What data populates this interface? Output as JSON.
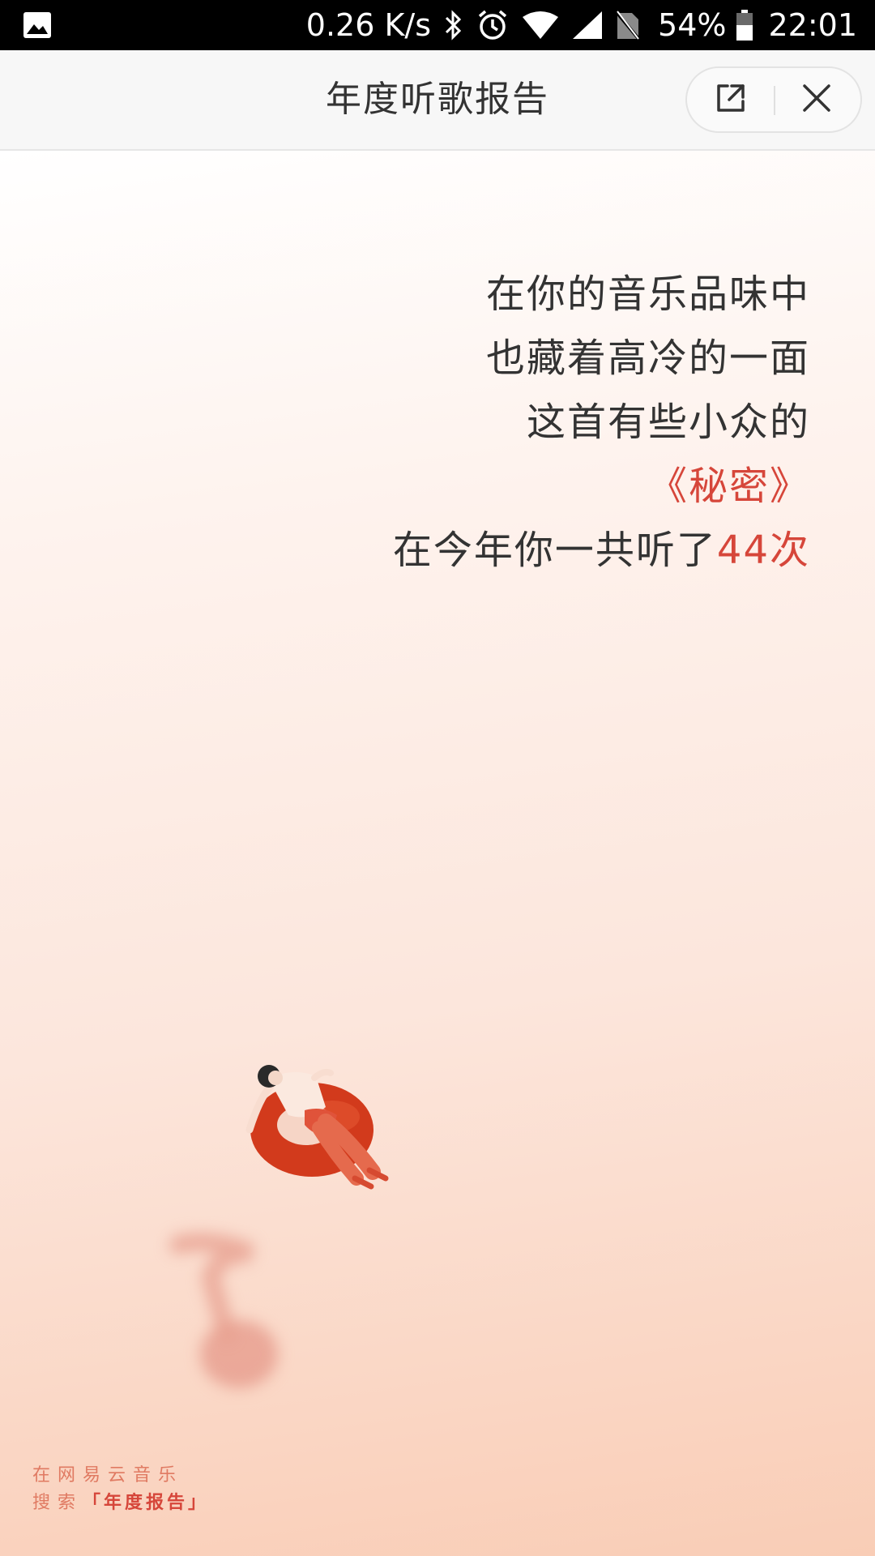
{
  "status_bar": {
    "speed": "0.26 K/s",
    "battery": "54%",
    "time": "22:01"
  },
  "header": {
    "title": "年度听歌报告"
  },
  "report": {
    "line1": "在你的音乐品味中",
    "line2": "也藏着高冷的一面",
    "line3": "这首有些小众的",
    "song": "《秘密》",
    "line5_prefix": "在今年你一共听了",
    "play_count": "44次"
  },
  "footer": {
    "line1": "在网易云音乐",
    "line2_prefix": "搜索",
    "keyword": "「年度报告」"
  },
  "colors": {
    "accent": "#d6463a",
    "text": "#333333",
    "bg_top": "#ffffff",
    "bg_bottom": "#f9cdb6"
  }
}
